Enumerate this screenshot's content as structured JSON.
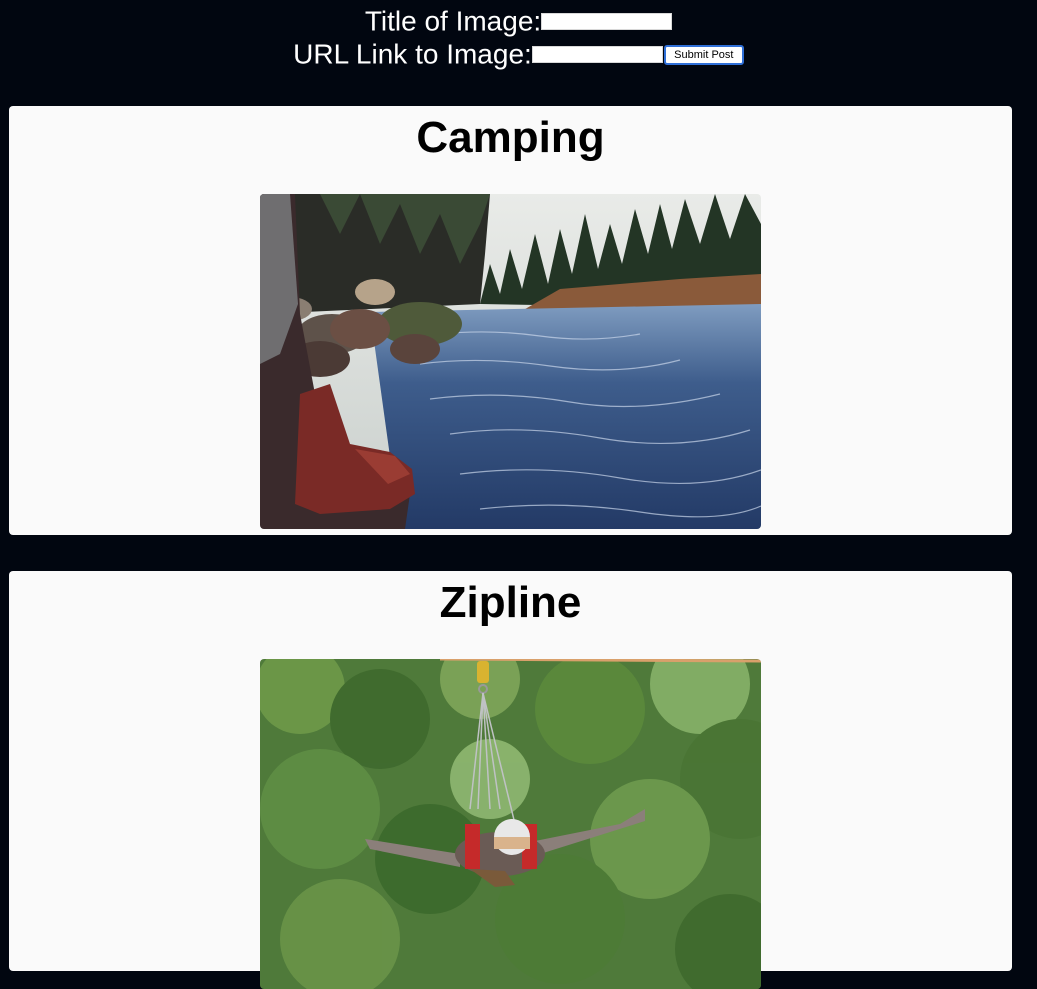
{
  "form": {
    "title_label": "Title of Image:",
    "title_value": "",
    "url_label": "URL Link to Image:",
    "url_value": "",
    "submit_label": "Submit Post"
  },
  "posts": [
    {
      "title": "Camping",
      "image": "river-camping-photo"
    },
    {
      "title": "Zipline",
      "image": "zipline-photo"
    }
  ],
  "colors": {
    "background": "#010610",
    "card": "#fafafa",
    "button_border": "#2f6fd8"
  }
}
